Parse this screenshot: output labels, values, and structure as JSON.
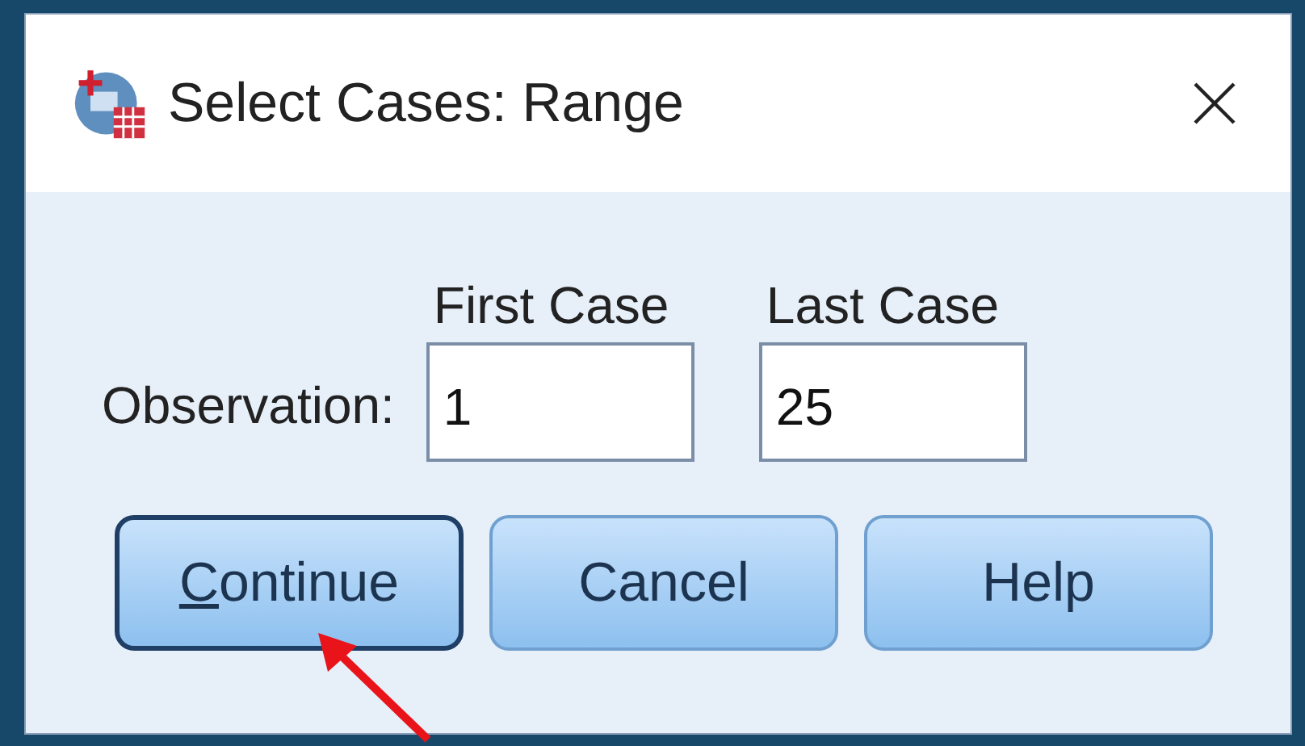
{
  "window": {
    "title": "Select Cases: Range"
  },
  "range": {
    "label": "Observation:",
    "columns": [
      {
        "heading": "First Case",
        "value": "1"
      },
      {
        "heading": "Last Case",
        "value": "25"
      }
    ]
  },
  "buttons": [
    {
      "label": "Continue",
      "focused": true
    },
    {
      "label": "Cancel",
      "focused": false
    },
    {
      "label": "Help",
      "focused": false
    }
  ]
}
